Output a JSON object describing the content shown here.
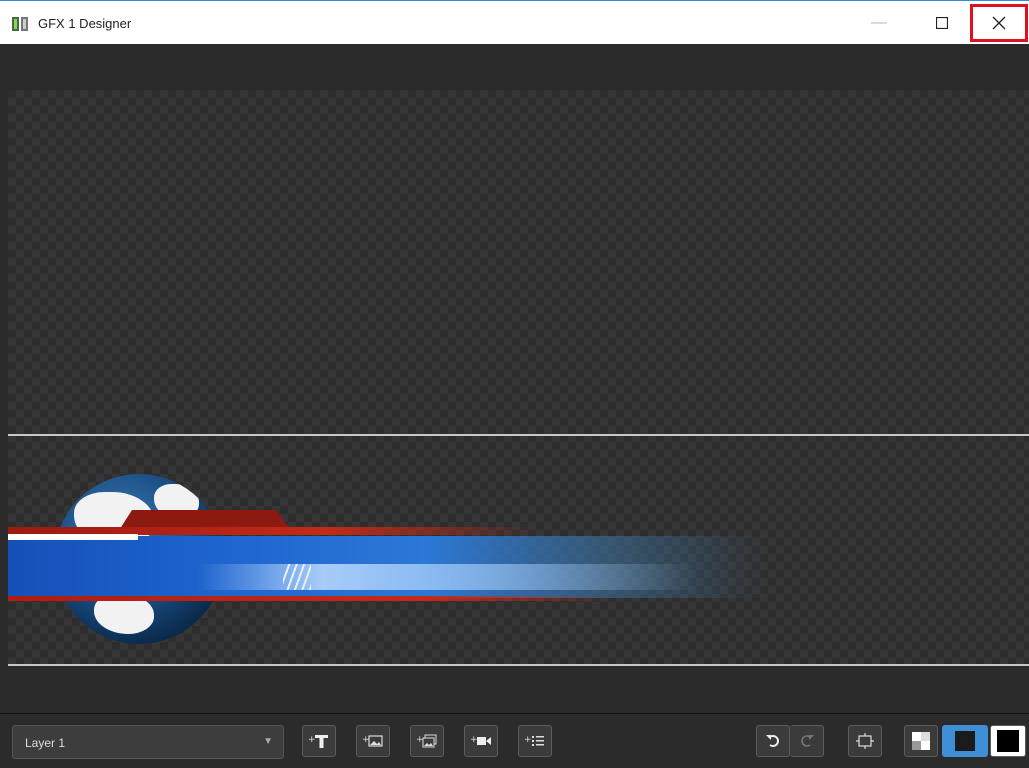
{
  "window": {
    "title": "GFX 1 Designer",
    "min_glyph": "—",
    "max_glyph": "☐",
    "close_glyph": "✕"
  },
  "toolbar": {
    "layer_select": {
      "value": "Layer 1",
      "caret": "▼"
    },
    "buttons": [
      {
        "name": "add-text-button",
        "icon": "text-plus-icon"
      },
      {
        "name": "add-image-button",
        "icon": "image-plus-icon"
      },
      {
        "name": "add-image-sequence-button",
        "icon": "image-sequence-plus-icon"
      },
      {
        "name": "add-video-button",
        "icon": "video-plus-icon"
      },
      {
        "name": "add-list-button",
        "icon": "list-plus-icon"
      },
      {
        "name": "undo-button",
        "icon": "undo-icon"
      },
      {
        "name": "redo-button",
        "icon": "redo-icon"
      },
      {
        "name": "safe-area-button",
        "icon": "safe-area-icon"
      },
      {
        "name": "background-checker-button",
        "icon": "checker-icon"
      },
      {
        "name": "background-blue-button",
        "icon": "blue-swatch-icon"
      },
      {
        "name": "background-black-button",
        "icon": "black-swatch-icon"
      }
    ],
    "plus_glyph": "+"
  },
  "colors": {
    "close_highlight": "#e01020",
    "accent_blue": "#1f66d0",
    "accent_red": "#c42a16"
  }
}
